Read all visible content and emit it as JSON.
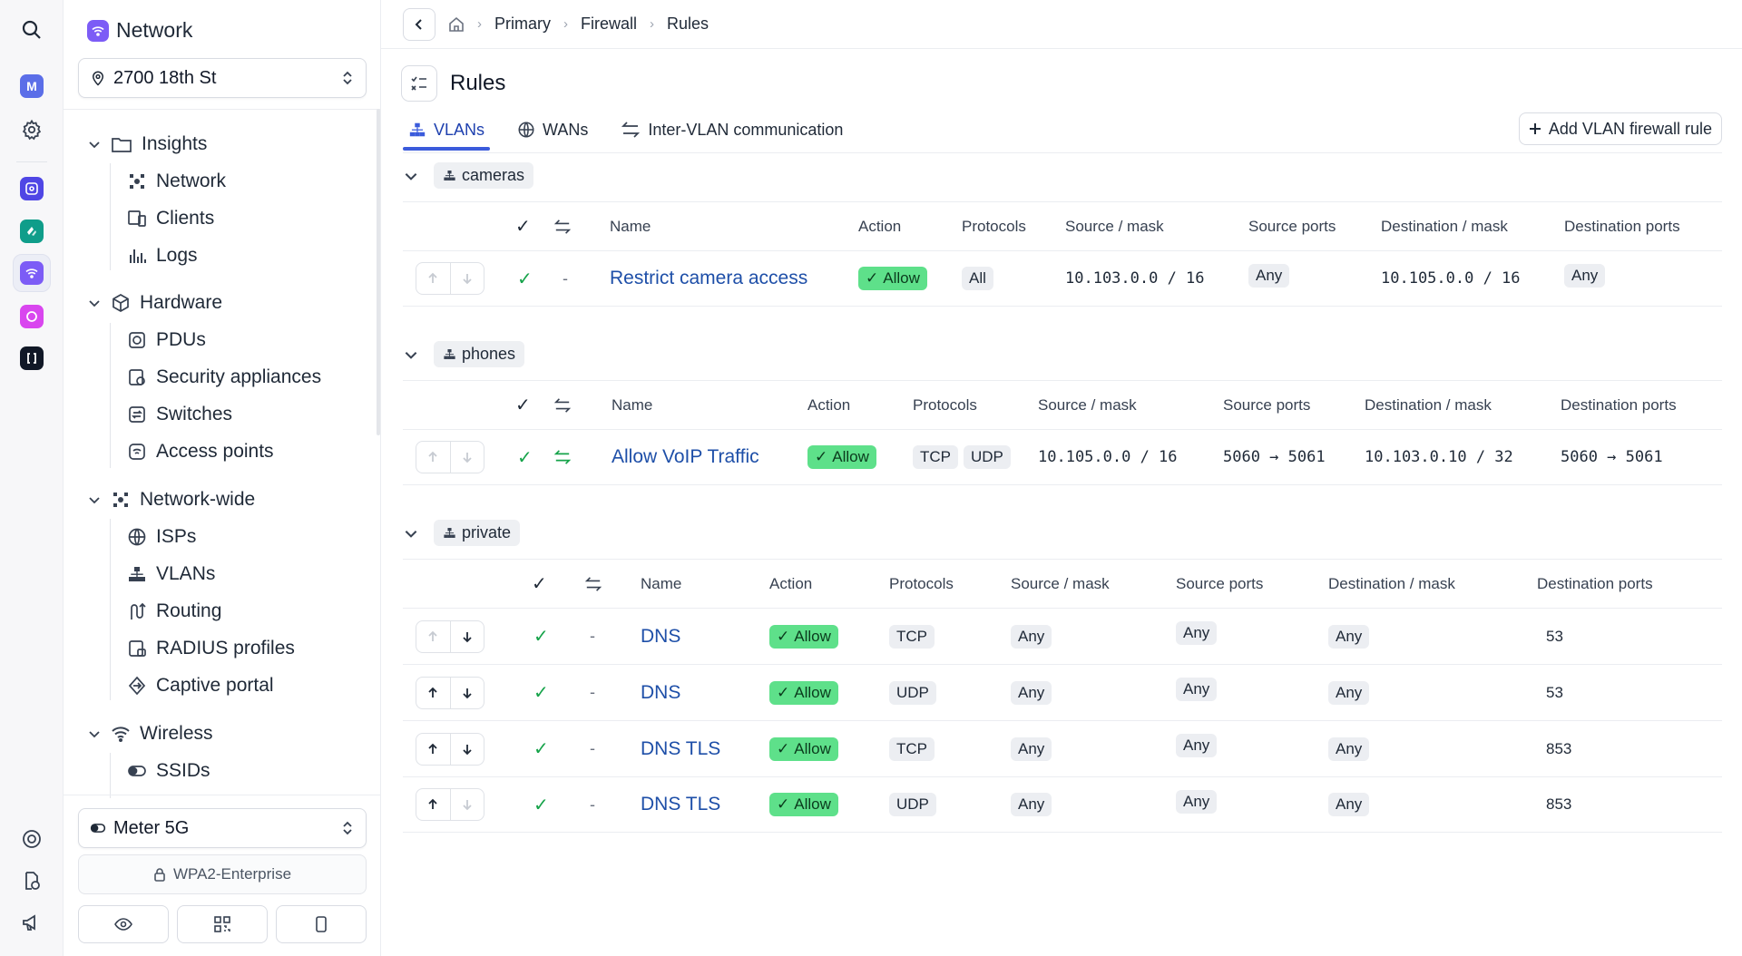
{
  "app": {
    "title": "Network",
    "location": "2700 18th St"
  },
  "rail": {
    "avatar_letter": "M",
    "colors": {
      "avatar": "#5b6ee8",
      "app1": "#4f46e5",
      "app2": "#0f9d8a",
      "app3": "#7c5cf6",
      "app4": "#d946ef",
      "app5": "#111827"
    }
  },
  "sidebar": {
    "groups": [
      {
        "label": "Insights",
        "icon": "folder-icon",
        "items": [
          {
            "label": "Network",
            "icon": "network-icon"
          },
          {
            "label": "Clients",
            "icon": "clients-icon"
          },
          {
            "label": "Logs",
            "icon": "logs-icon"
          }
        ]
      },
      {
        "label": "Hardware",
        "icon": "cube-icon",
        "items": [
          {
            "label": "PDUs",
            "icon": "pdu-icon"
          },
          {
            "label": "Security appliances",
            "icon": "security-appliance-icon"
          },
          {
            "label": "Switches",
            "icon": "switch-icon"
          },
          {
            "label": "Access points",
            "icon": "access-point-icon"
          }
        ]
      },
      {
        "label": "Network-wide",
        "icon": "network-icon",
        "items": [
          {
            "label": "ISPs",
            "icon": "globe-icon"
          },
          {
            "label": "VLANs",
            "icon": "vlan-icon"
          },
          {
            "label": "Routing",
            "icon": "routing-icon"
          },
          {
            "label": "RADIUS profiles",
            "icon": "radius-icon"
          },
          {
            "label": "Captive portal",
            "icon": "captive-portal-icon"
          }
        ]
      },
      {
        "label": "Wireless",
        "icon": "wifi-icon",
        "items": [
          {
            "label": "SSIDs",
            "icon": "toggle-icon"
          }
        ]
      }
    ],
    "ssid_select": "Meter 5G",
    "security": "WPA2-Enterprise"
  },
  "breadcrumb": {
    "items": [
      "Primary",
      "Firewall",
      "Rules"
    ]
  },
  "page": {
    "title": "Rules"
  },
  "tabs": [
    {
      "label": "VLANs",
      "icon": "vlan-icon",
      "active": true
    },
    {
      "label": "WANs",
      "icon": "globe-icon",
      "active": false
    },
    {
      "label": "Inter-VLAN communication",
      "icon": "arrows-swap-icon",
      "active": false
    }
  ],
  "actions": {
    "add_rule": "Add VLAN firewall rule"
  },
  "columns": {
    "name": "Name",
    "action": "Action",
    "protocols": "Protocols",
    "source_mask": "Source / mask",
    "source_ports": "Source ports",
    "dest_mask": "Destination / mask",
    "dest_ports": "Destination ports"
  },
  "groups": [
    {
      "vlan": "cameras",
      "rules": [
        {
          "name": "Restrict camera access",
          "action": "Allow",
          "bidirectional": "-",
          "protocols": [
            "All"
          ],
          "source_mask": "10.103.0.0 / 16",
          "source_ports": "Any",
          "dest_mask": "10.105.0.0 / 16",
          "dest_ports": "Any"
        }
      ]
    },
    {
      "vlan": "phones",
      "rules": [
        {
          "name": "Allow VoIP Traffic",
          "action": "Allow",
          "bidirectional": "yes",
          "protocols": [
            "TCP",
            "UDP"
          ],
          "source_mask": "10.105.0.0 / 16",
          "source_ports": "5060 → 5061",
          "dest_mask": "10.103.0.10 / 32",
          "dest_ports": "5060 → 5061"
        }
      ]
    },
    {
      "vlan": "private",
      "rules": [
        {
          "name": "DNS",
          "action": "Allow",
          "bidirectional": "-",
          "protocols": [
            "TCP"
          ],
          "source_mask": "Any",
          "source_ports": "Any",
          "dest_mask": "Any",
          "dest_ports": "53"
        },
        {
          "name": "DNS",
          "action": "Allow",
          "bidirectional": "-",
          "protocols": [
            "UDP"
          ],
          "source_mask": "Any",
          "source_ports": "Any",
          "dest_mask": "Any",
          "dest_ports": "53"
        },
        {
          "name": "DNS TLS",
          "action": "Allow",
          "bidirectional": "-",
          "protocols": [
            "TCP"
          ],
          "source_mask": "Any",
          "source_ports": "Any",
          "dest_mask": "Any",
          "dest_ports": "853"
        },
        {
          "name": "DNS TLS",
          "action": "Allow",
          "bidirectional": "-",
          "protocols": [
            "UDP"
          ],
          "source_mask": "Any",
          "source_ports": "Any",
          "dest_mask": "Any",
          "dest_ports": "853"
        }
      ]
    }
  ]
}
